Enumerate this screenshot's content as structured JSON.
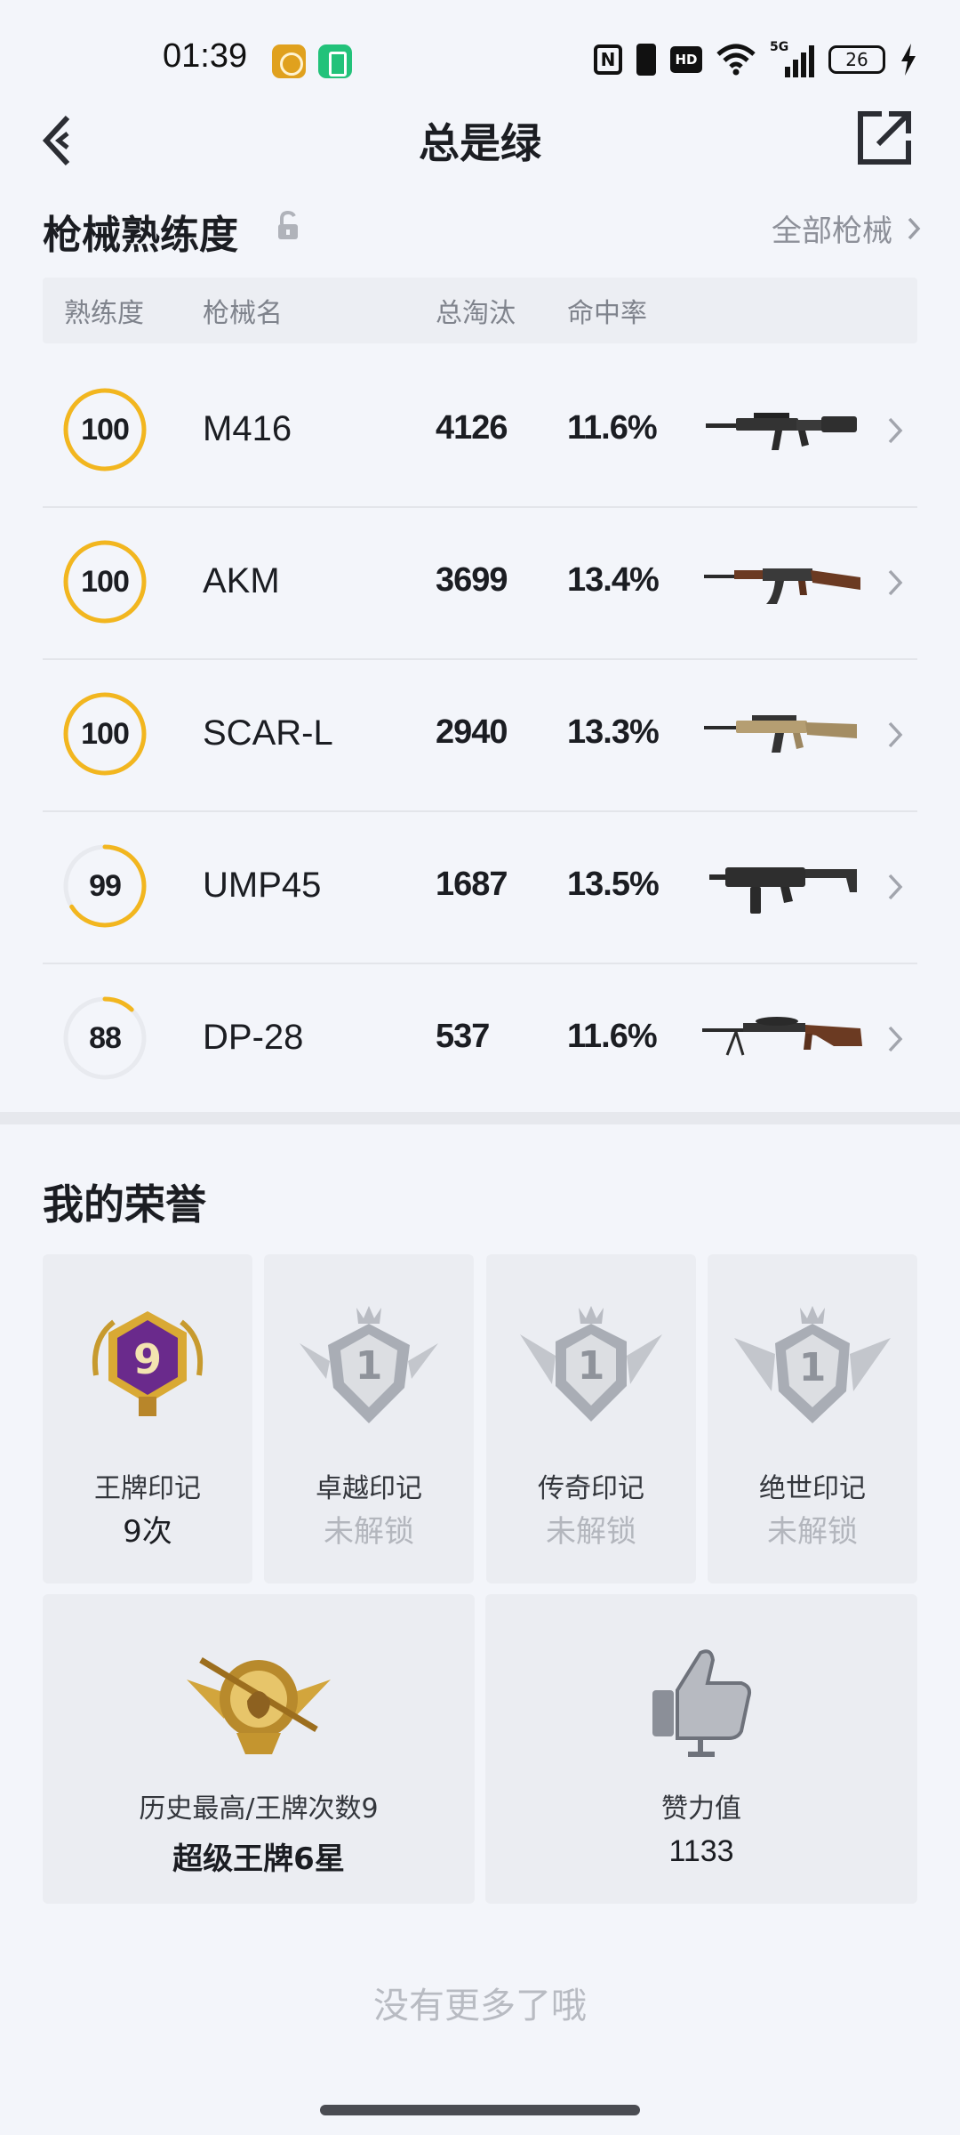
{
  "status_bar": {
    "time": "01:39",
    "battery": "26",
    "nfc": "N",
    "hd": "HD",
    "network": "5G"
  },
  "header": {
    "title": "总是绿",
    "back_icon": "back-arrow-icon",
    "share_icon": "share-icon"
  },
  "weapons": {
    "title": "枪械熟练度",
    "all_link": "全部枪械",
    "columns": [
      "熟练度",
      "枪械名",
      "总淘汰",
      "命中率"
    ],
    "rows": [
      {
        "mastery": "100",
        "mastery_fraction": 1.0,
        "name": "M416",
        "kills": "4126",
        "hit_rate": "11.6%",
        "gun_icon": "m416-rifle-image"
      },
      {
        "mastery": "100",
        "mastery_fraction": 1.0,
        "name": "AKM",
        "kills": "3699",
        "hit_rate": "13.4%",
        "gun_icon": "akm-rifle-image"
      },
      {
        "mastery": "100",
        "mastery_fraction": 1.0,
        "name": "SCAR-L",
        "kills": "2940",
        "hit_rate": "13.3%",
        "gun_icon": "scar-l-rifle-image"
      },
      {
        "mastery": "99",
        "mastery_fraction": 0.66,
        "name": "UMP45",
        "kills": "1687",
        "hit_rate": "13.5%",
        "gun_icon": "ump45-smg-image"
      },
      {
        "mastery": "88",
        "mastery_fraction": 0.12,
        "name": "DP-28",
        "kills": "537",
        "hit_rate": "11.6%",
        "gun_icon": "dp28-lmg-image"
      }
    ],
    "ring_color": "#f2b61f",
    "ring_track_color": "#e8eaef"
  },
  "honors": {
    "title": "我的荣誉",
    "badges": [
      {
        "label": "王牌印记",
        "value": "9次",
        "locked": false,
        "badge_number": "9"
      },
      {
        "label": "卓越印记",
        "value": "未解锁",
        "locked": true,
        "badge_number": "1"
      },
      {
        "label": "传奇印记",
        "value": "未解锁",
        "locked": true,
        "badge_number": "1"
      },
      {
        "label": "绝世印记",
        "value": "未解锁",
        "locked": true,
        "badge_number": "1"
      }
    ],
    "highest": {
      "label": "历史最高/王牌次数9",
      "value": "超级王牌6星"
    },
    "likes": {
      "label": "赞力值",
      "value": "1133"
    }
  },
  "footer": "没有更多了哦"
}
